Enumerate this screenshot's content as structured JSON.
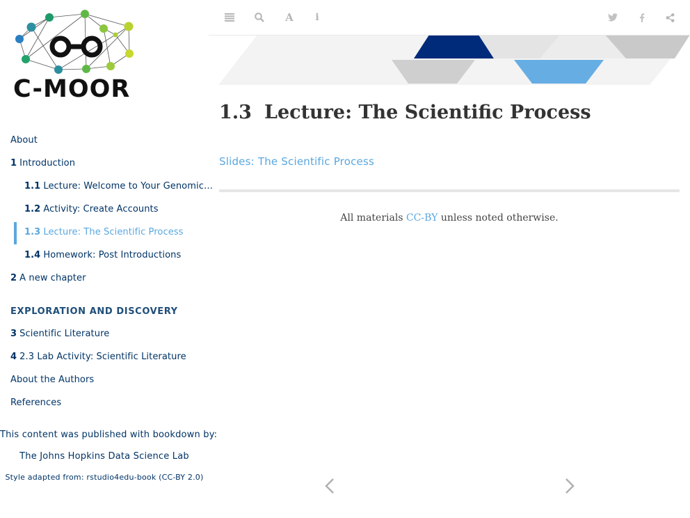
{
  "logo": {
    "text": "C-MOOR"
  },
  "sidebar": {
    "items": [
      {
        "num": "",
        "label": "About"
      },
      {
        "num": "1",
        "label": "Introduction"
      },
      {
        "num": "1.1",
        "label": "Lecture: Welcome to Your Genomic…"
      },
      {
        "num": "1.2",
        "label": "Activity: Create Accounts"
      },
      {
        "num": "1.3",
        "label": "Lecture: The Scientific Process"
      },
      {
        "num": "1.4",
        "label": "Homework: Post Introductions"
      },
      {
        "num": "2",
        "label": "A new chapter"
      }
    ],
    "section_heading": "EXPLORATION AND DISCOVERY",
    "items2": [
      {
        "num": "3",
        "label": "Scientific Literature"
      },
      {
        "num": "4",
        "label": "2.3 Lab Activity: Scientific Literature"
      },
      {
        "num": "",
        "label": "About the Authors"
      },
      {
        "num": "",
        "label": "References"
      }
    ],
    "footer": {
      "published": "This content was published with bookdown by:",
      "lab": "The Johns Hopkins Data Science Lab",
      "style": "Style adapted from: rstudio4edu-book (CC-BY 2.0)"
    }
  },
  "toolbar": {
    "left_icons": [
      "list-icon",
      "search-icon",
      "font-icon",
      "info-icon"
    ],
    "right_icons": [
      "twitter-icon",
      "facebook-icon",
      "share-icon"
    ]
  },
  "content": {
    "title_num": "1.3",
    "title_text": "Lecture: The Scientific Process",
    "slides_link": "Slides: The Scientific Process",
    "license_before": "All materials",
    "license_link": "CC-BY",
    "license_after": "unless noted otherwise."
  },
  "colors": {
    "navy": "#003366",
    "accent": "#5aa7e0",
    "banner_dark": "#002b7a",
    "banner_gray": "#c9c9c9"
  }
}
